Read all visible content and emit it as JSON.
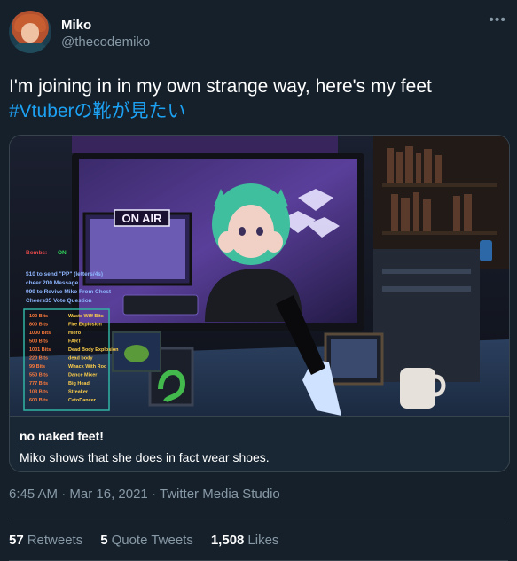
{
  "author": {
    "name": "Miko",
    "handle": "@thecodemiko"
  },
  "more_icon": "more-horizontal-icon",
  "tweet": {
    "text": "I'm joining in in my own strange way, here's my feet",
    "hashtag": "#Vtuberの靴が見たい"
  },
  "card": {
    "title": "no naked feet!",
    "description": "Miko shows that she does in fact wear shoes.",
    "media": {
      "sign": "ON AIR",
      "overlay": {
        "bombs_label": "Bombs:",
        "bombs_value": "ON",
        "commands": [
          "$10 to send \"PP\" (letters/4s)",
          "cheer 200 Message",
          "999 to Revive Miko From Chest",
          "Cheers35 Vote Question"
        ],
        "bits_table": [
          {
            "bits": "100 Bits",
            "action": "Waste Wiff Bits"
          },
          {
            "bits": "800 Bits",
            "action": "Fire Explosion"
          },
          {
            "bits": "1000 Bits",
            "action": "Hiero"
          },
          {
            "bits": "500 Bits",
            "action": "FART"
          },
          {
            "bits": "1001 Bits",
            "action": "Dead Body Explosion"
          },
          {
            "bits": "220 Bits",
            "action": "dead body"
          },
          {
            "bits": "99 Bits",
            "action": "Whack With Rod"
          },
          {
            "bits": "550 Bits",
            "action": "Dance Mixer"
          },
          {
            "bits": "777 Bits",
            "action": "Big Head"
          },
          {
            "bits": "103 Bits",
            "action": "Streaker"
          },
          {
            "bits": "600 Bits",
            "action": "CatoDancer"
          }
        ]
      }
    }
  },
  "meta": {
    "time": "6:45 AM",
    "date": "Mar 16, 2021",
    "separator": "·",
    "source": "Twitter Media Studio"
  },
  "stats": {
    "retweets_count": "57",
    "retweets_label": "Retweets",
    "quotes_count": "5",
    "quotes_label": "Quote Tweets",
    "likes_count": "1,508",
    "likes_label": "Likes"
  }
}
